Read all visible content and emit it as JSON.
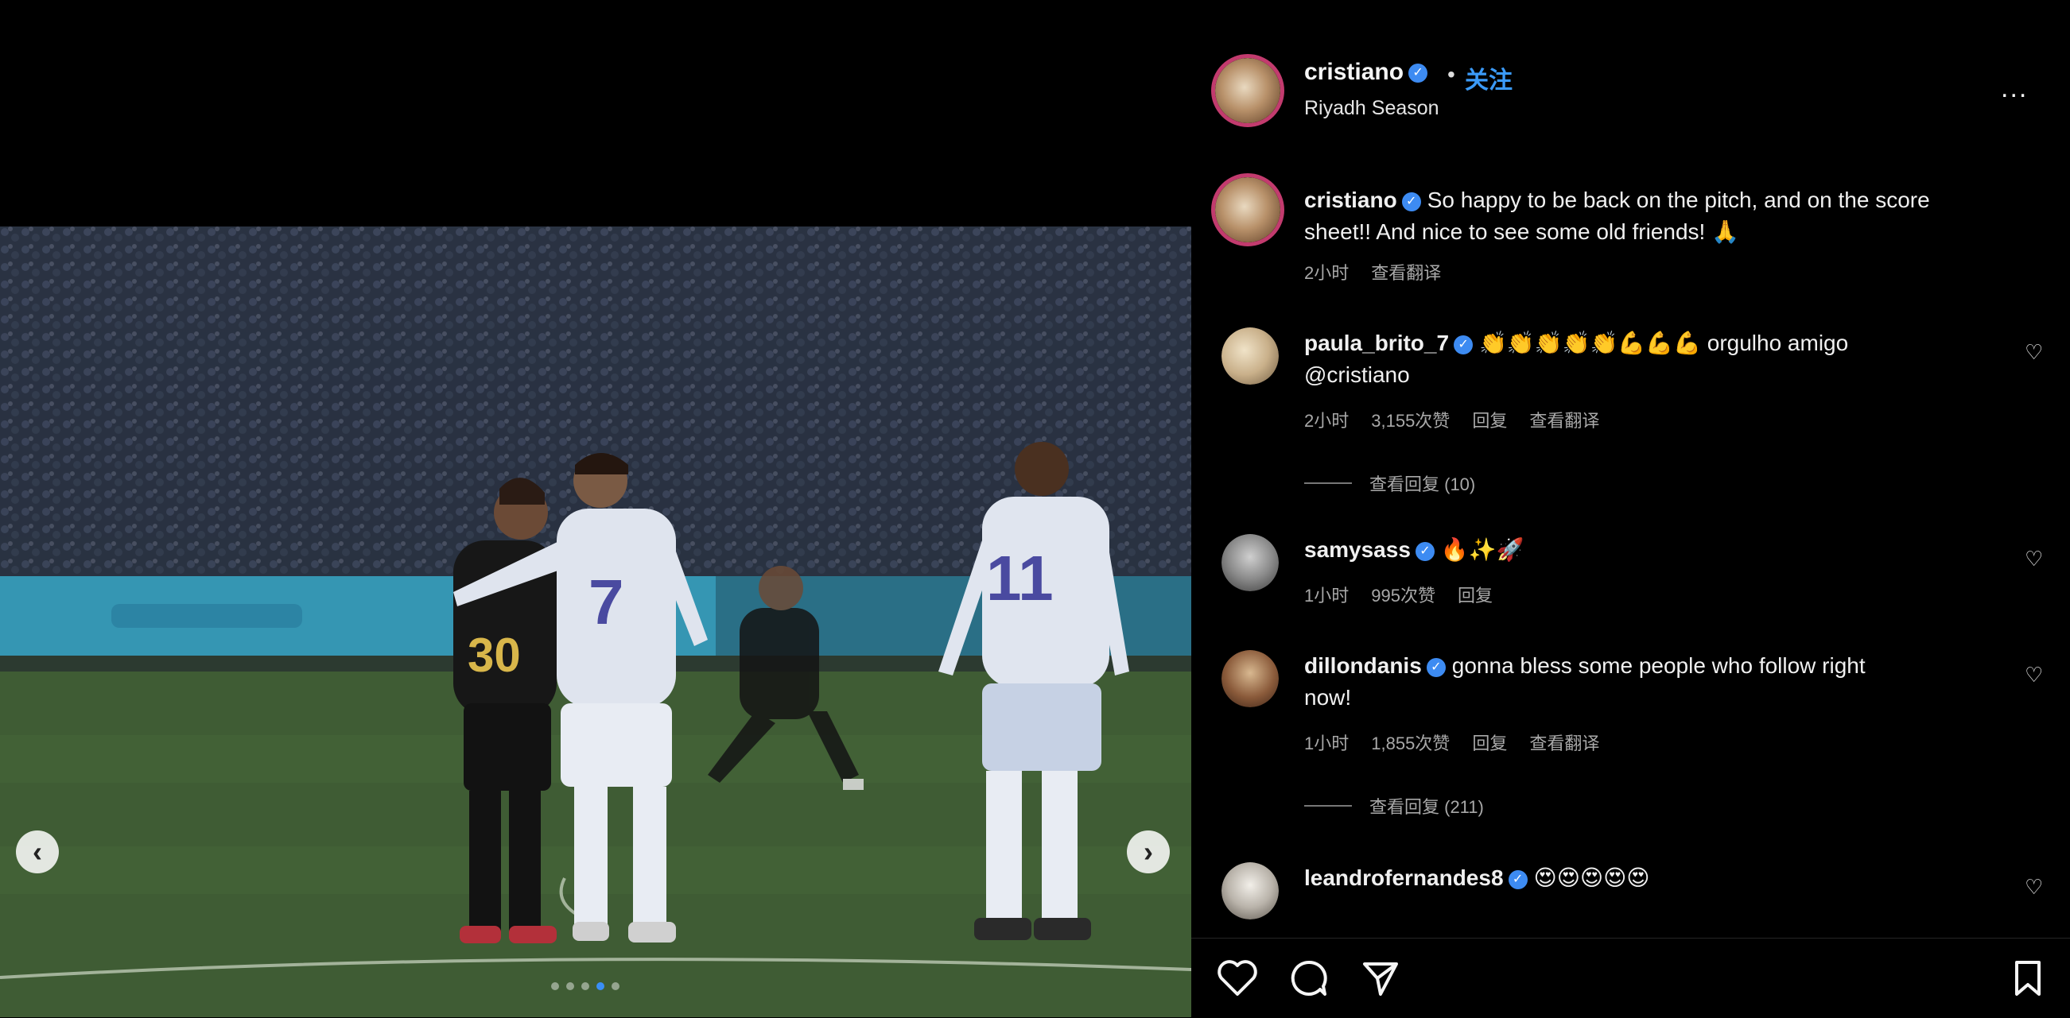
{
  "post": {
    "carousel_total": 5,
    "carousel_active": 3
  },
  "header": {
    "username": "cristiano",
    "separator": "•",
    "follow_label": "关注",
    "location": "Riyadh Season",
    "more_label": "..."
  },
  "caption": {
    "username": "cristiano",
    "text": "So happy to be back on the pitch, and on the score",
    "text2": "sheet!! And nice to see some old friends! 🙏",
    "time": "2小时",
    "see_translation": "查看翻译"
  },
  "comments": [
    {
      "username": "paula_brito_7",
      "text": "👏👏👏👏👏💪💪💪 orgulho amigo",
      "text2": "@cristiano",
      "time": "2小时",
      "likes": "3,155次赞",
      "reply": "回复",
      "see_translation": "查看翻译",
      "view_replies": "查看回复 (10)"
    },
    {
      "username": "samysass",
      "text": "🔥✨🚀",
      "time": "1小时",
      "likes": "995次赞",
      "reply": "回复"
    },
    {
      "username": "dillondanis",
      "text": "gonna bless some people who follow right",
      "text2": "now!",
      "time": "1小时",
      "likes": "1,855次赞",
      "reply": "回复",
      "see_translation": "查看翻译",
      "view_replies": "查看回复 (211)"
    },
    {
      "username": "leandrofernandes8",
      "text": "😍😍😍😍😍"
    }
  ],
  "icons": {
    "heart": "heart-icon",
    "comment": "comment-icon",
    "share": "share-icon",
    "save": "bookmark-icon",
    "verified": "verified-badge-icon"
  },
  "colors": {
    "background": "#000000",
    "link_blue": "#3b9af8",
    "verified_blue": "#3d8bf2",
    "muted_text": "#a8a8a8"
  }
}
